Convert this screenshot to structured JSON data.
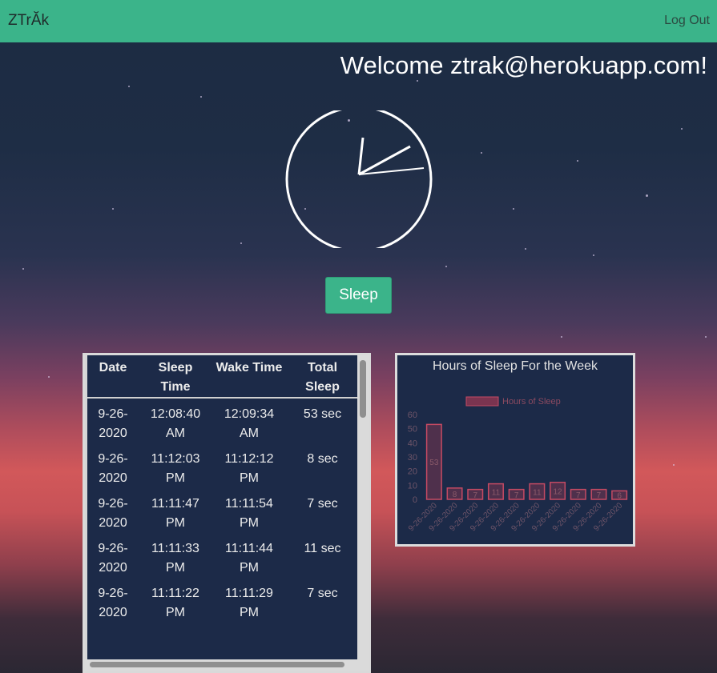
{
  "navbar": {
    "brand": "ZTrĂk",
    "logout_label": "Log Out",
    "background": "#3bb48a"
  },
  "welcome_text": "Welcome ztrak@herokuapp.com!",
  "sleep_button_label": "Sleep",
  "table": {
    "headers": [
      "Date",
      "Sleep Time",
      "Wake Time",
      "Total Sleep"
    ],
    "rows": [
      [
        "9-26-2020",
        "12:08:40 AM",
        "12:09:34 AM",
        "53 sec"
      ],
      [
        "9-26-2020",
        "11:12:03 PM",
        "11:12:12 PM",
        "8 sec"
      ],
      [
        "9-26-2020",
        "11:11:47 PM",
        "11:11:54 PM",
        "7 sec"
      ],
      [
        "9-26-2020",
        "11:11:33 PM",
        "11:11:44 PM",
        "11 sec"
      ],
      [
        "9-26-2020",
        "11:11:22 PM",
        "11:11:29 PM",
        "7 sec"
      ]
    ]
  },
  "chart_data": {
    "type": "bar",
    "title": "Hours of Sleep For the Week",
    "legend": "Hours of Sleep",
    "legend_position": "top",
    "categories": [
      "9-26-2020",
      "9-26-2020",
      "9-26-2020",
      "9-26-2020",
      "9-26-2020",
      "9-26-2020",
      "9-26-2020",
      "9-26-2020",
      "9-26-2020",
      "9-26-2020"
    ],
    "values": [
      53,
      8,
      7,
      11,
      7,
      11,
      12,
      7,
      7,
      6
    ],
    "ylim": [
      0,
      60
    ],
    "yticks": [
      0,
      10,
      20,
      30,
      40,
      50,
      60
    ],
    "bar_color": "#c44a63",
    "grid": false
  }
}
